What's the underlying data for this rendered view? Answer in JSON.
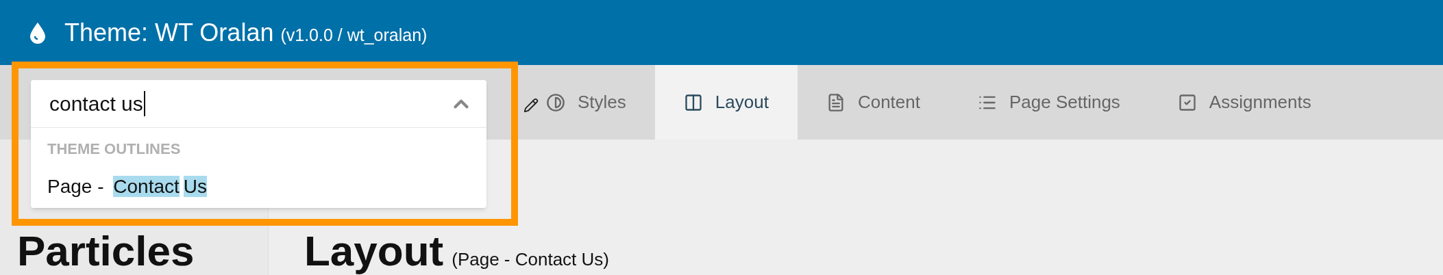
{
  "header": {
    "title": "Theme: WT Oralan",
    "subtitle": "(v1.0.0 / wt_oralan)"
  },
  "tabs": [
    {
      "label": "Styles",
      "selected": false
    },
    {
      "label": "Layout",
      "selected": true
    },
    {
      "label": "Content",
      "selected": false
    },
    {
      "label": "Page Settings",
      "selected": false
    },
    {
      "label": "Assignments",
      "selected": false
    }
  ],
  "search": {
    "value": "contact us",
    "expanded": true,
    "group": "THEME OUTLINES",
    "results": [
      {
        "parts": [
          {
            "text": "Page - ",
            "match": false
          },
          {
            "text": "Contact",
            "match": true
          },
          {
            "text": "Us",
            "match": true
          }
        ]
      }
    ]
  },
  "sidebar": {
    "heading": "Particles"
  },
  "main": {
    "heading": "Layout",
    "subheading": "(Page - Contact Us)"
  }
}
